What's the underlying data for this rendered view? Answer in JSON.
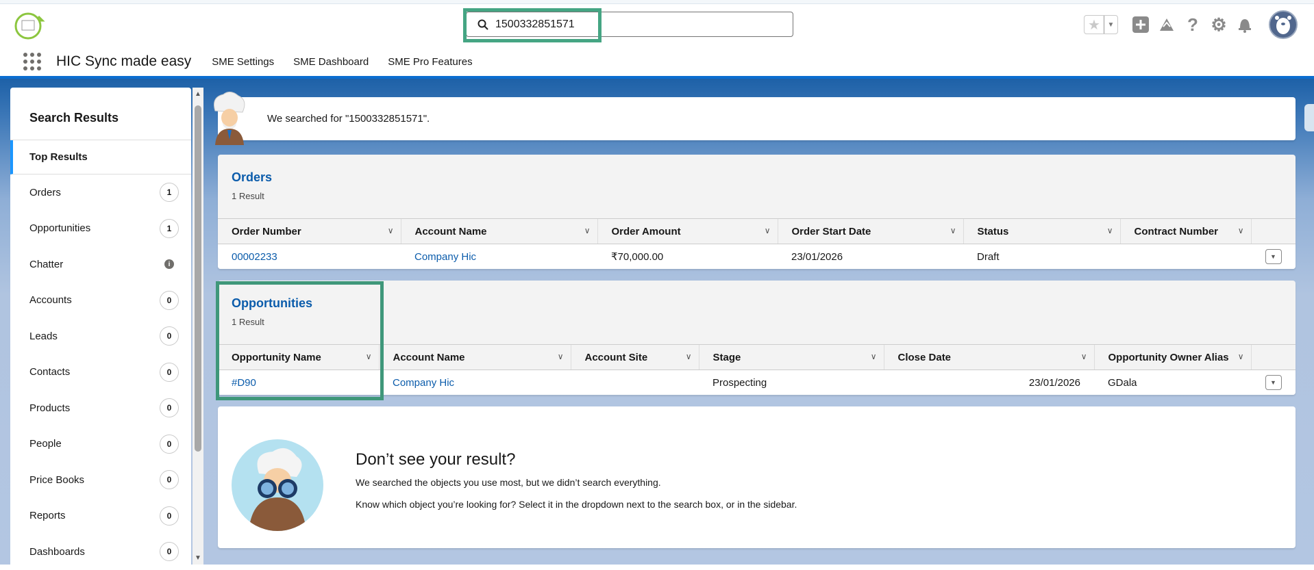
{
  "header": {
    "search_value": "1500332851571",
    "app_name": "HIC Sync made easy",
    "nav": [
      "SME Settings",
      "SME Dashboard",
      "SME Pro Features"
    ]
  },
  "sidebar": {
    "title": "Search Results",
    "top": "Top Results",
    "items": [
      {
        "label": "Orders",
        "count": "1"
      },
      {
        "label": "Opportunities",
        "count": "1"
      },
      {
        "label": "Chatter",
        "count": ""
      },
      {
        "label": "Accounts",
        "count": "0"
      },
      {
        "label": "Leads",
        "count": "0"
      },
      {
        "label": "Contacts",
        "count": "0"
      },
      {
        "label": "Products",
        "count": "0"
      },
      {
        "label": "People",
        "count": "0"
      },
      {
        "label": "Price Books",
        "count": "0"
      },
      {
        "label": "Reports",
        "count": "0"
      },
      {
        "label": "Dashboards",
        "count": "0"
      }
    ]
  },
  "searched": "We searched for \"1500332851571\".",
  "orders": {
    "title": "Orders",
    "sub": "1 Result",
    "columns": [
      "Order Number",
      "Account Name",
      "Order Amount",
      "Order Start Date",
      "Status",
      "Contract Number"
    ],
    "row": [
      "00002233",
      "Company Hic",
      "₹70,000.00",
      "23/01/2026",
      "Draft",
      ""
    ]
  },
  "opps": {
    "title": "Opportunities",
    "sub": "1 Result",
    "columns": [
      "Opportunity Name",
      "Account Name",
      "Account Site",
      "Stage",
      "Close Date",
      "Opportunity Owner Alias"
    ],
    "row": [
      "#D90",
      "Company Hic",
      "",
      "Prospecting",
      "23/01/2026",
      "GDala"
    ]
  },
  "bottom": {
    "heading": "Don’t see your result?",
    "line1": "We searched the objects you use most, but we didn’t search everything.",
    "line2": "Know which object you’re looking for? Select it in the dropdown next to the search box, or in the sidebar."
  }
}
